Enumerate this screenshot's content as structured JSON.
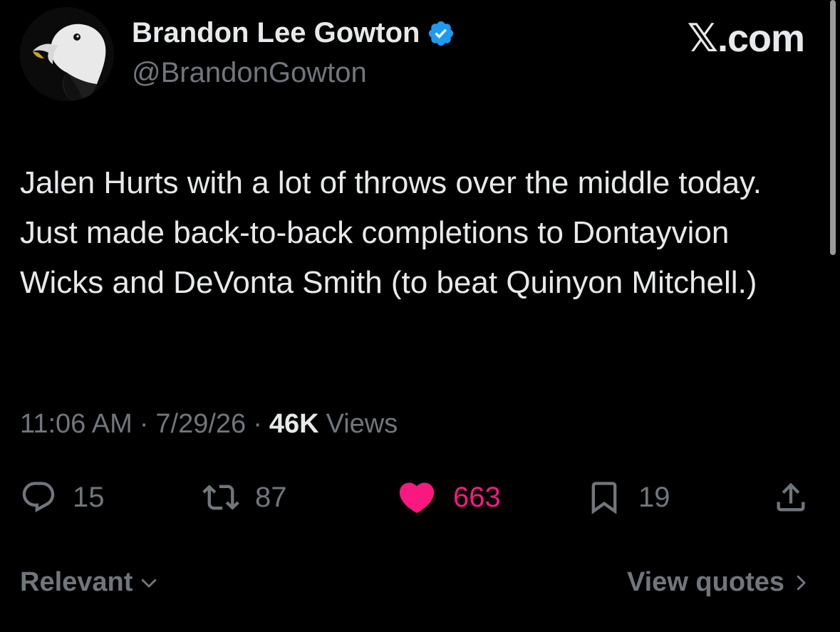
{
  "author": {
    "display_name": "Brandon Lee Gowton",
    "handle": "@BrandonGowton",
    "verified": true,
    "verified_color": "#1d9bf0",
    "avatar_icon": "bald-eagle-avatar"
  },
  "brand": "𝕏.com",
  "tweet": {
    "text": "Jalen Hurts with a lot of throws over the middle today. Just made back-to-back completions to Dontayvion Wicks and DeVonta Smith (to beat Quinyon Mitchell.)"
  },
  "meta": {
    "time": "11:06 AM",
    "separator": "·",
    "date": "7/29/26",
    "views_count": "46K",
    "views_label": "Views"
  },
  "actions": {
    "replies": {
      "icon": "reply-icon",
      "count": "15"
    },
    "reposts": {
      "icon": "repost-icon",
      "count": "87"
    },
    "likes": {
      "icon": "heart-icon",
      "count": "663",
      "liked": true,
      "color": "#f91880"
    },
    "bookmarks": {
      "icon": "bookmark-icon",
      "count": "19"
    },
    "share": {
      "icon": "share-icon"
    }
  },
  "footer": {
    "sort_label": "Relevant",
    "view_quotes_label": "View quotes"
  },
  "colors": {
    "background": "#000000",
    "text_primary": "#e7e9ea",
    "text_secondary": "#71767b",
    "like": "#f91880",
    "verified": "#1d9bf0"
  }
}
